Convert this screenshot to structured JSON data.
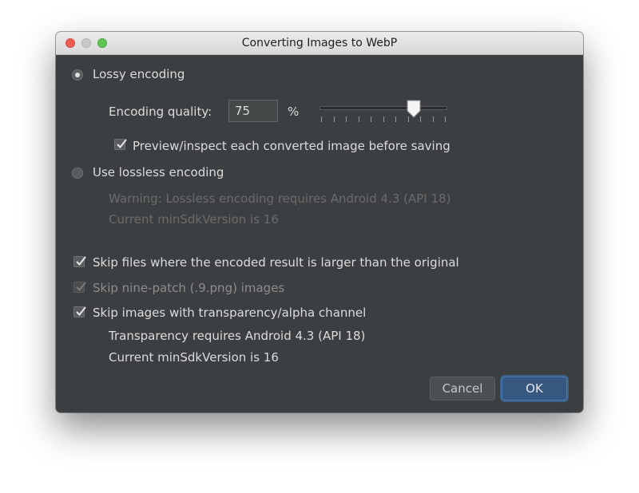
{
  "window": {
    "title": "Converting Images to WebP"
  },
  "lossy": {
    "label": "Lossy encoding",
    "selected": true,
    "quality_label": "Encoding quality:",
    "quality_value": "75",
    "quality_unit": "%",
    "slider_level_percent": 75,
    "preview_label": "Preview/inspect each converted image before saving",
    "preview_checked": true
  },
  "lossless": {
    "label": "Use lossless encoding",
    "selected": false,
    "warning_line1": "Warning: Lossless encoding requires Android 4.3 (API 18)",
    "warning_line2": "Current minSdkVersion is 16"
  },
  "options": {
    "skip_larger_label": "Skip files where the encoded result is larger than the original",
    "skip_larger_checked": true,
    "skip_ninepatch_label": "Skip nine-patch (.9.png) images",
    "skip_ninepatch_checked": true,
    "skip_transparency_label": "Skip images with transparency/alpha channel",
    "skip_transparency_checked": true,
    "transparency_note_line1": "Transparency requires Android 4.3 (API 18)",
    "transparency_note_line2": "Current minSdkVersion is 16"
  },
  "buttons": {
    "cancel": "Cancel",
    "ok": "OK"
  },
  "colors": {
    "background": "#3c3f41",
    "default_button": "#365880",
    "disabled_text": "#6b6b6b"
  }
}
